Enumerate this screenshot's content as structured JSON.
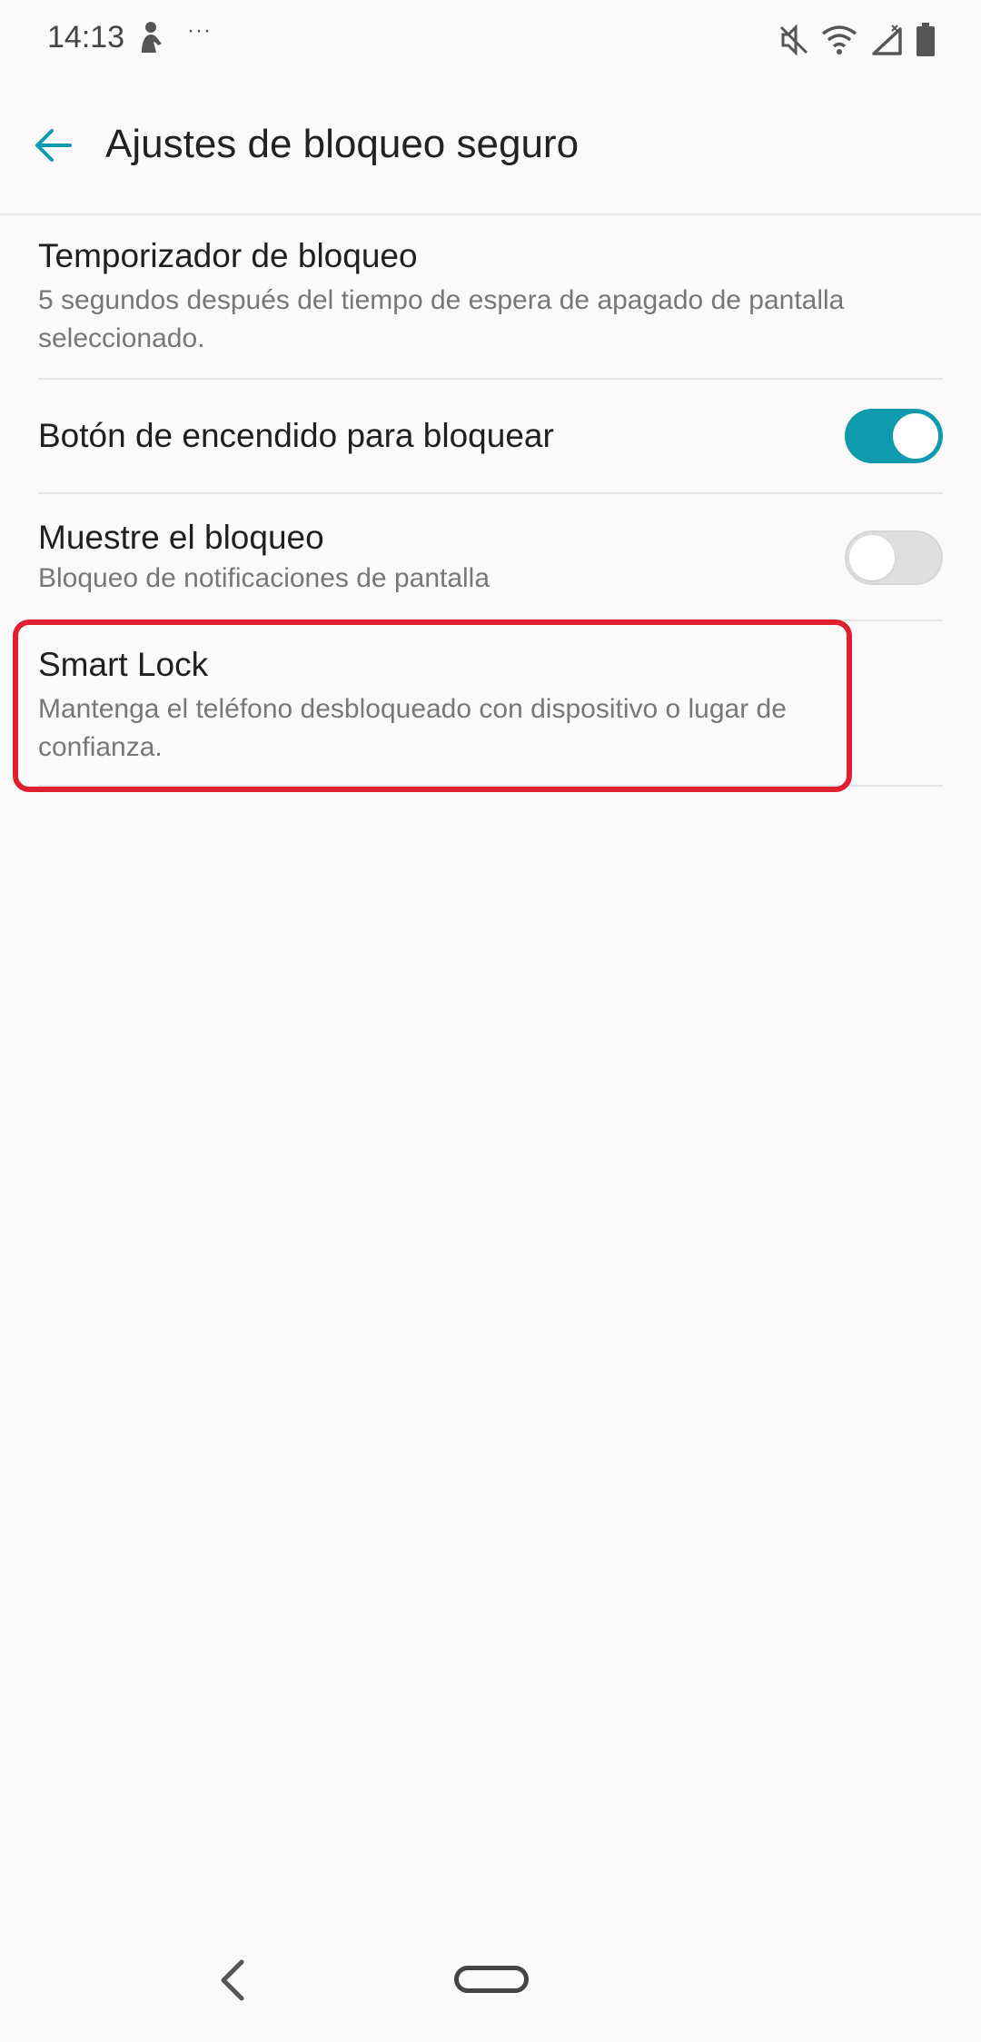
{
  "status_bar": {
    "time": "14:13",
    "dots": "···",
    "icons": [
      "user-notification-icon",
      "mute-icon",
      "wifi-icon",
      "signal-icon",
      "battery-icon"
    ]
  },
  "app_bar": {
    "title": "Ajustes de bloqueo seguro",
    "back_icon": "arrow-left-icon",
    "accent_color": "#0f9aae"
  },
  "settings": [
    {
      "title": "Temporizador de bloqueo",
      "subtitle": "5 segundos después del tiempo de espera de apagado de pantalla seleccionado."
    },
    {
      "title": "Botón de encendido para bloquear",
      "toggle": true
    },
    {
      "title": "Muestre el bloqueo",
      "subtitle": "Bloqueo de notificaciones de pantalla",
      "toggle": false
    },
    {
      "title": "Smart Lock",
      "subtitle": "Mantenga el teléfono desbloqueado con dispositivo o lugar de confianza."
    }
  ],
  "highlight_color": "#e0202f",
  "nav_bar": {
    "icons": [
      "nav-back-icon",
      "nav-home-icon"
    ]
  }
}
